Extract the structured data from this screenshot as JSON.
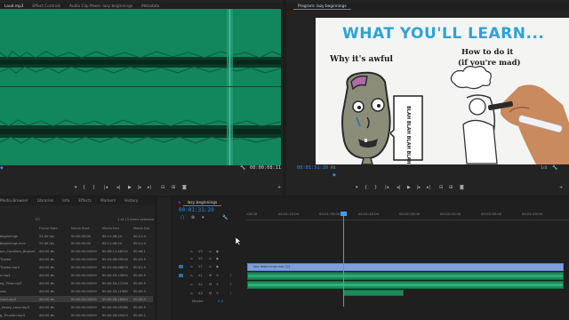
{
  "source_panel": {
    "tabs": [
      "Loud.mp3",
      "Effect Controls",
      "Audio Clip Mixer: lazy beginnings",
      "Metadata"
    ],
    "active_tab": 0,
    "timecode_right": "00:00:08:11",
    "waveform_color": "#12865c"
  },
  "program_panel": {
    "tab_label": "Program: lazy beginnings",
    "timecode": "00:01:31:20",
    "fit": "Fit",
    "fraction": "1/4",
    "frame": {
      "headline": "WHAT YOU'LL LEARN...",
      "left_caption": "Why it's awful",
      "right_caption_line1": "How to do it",
      "right_caption_line2": "(if you're mad)",
      "speech_bubble": "BLAH BLAH BLAH BLAH",
      "headline_color": "#2da3d9"
    }
  },
  "project_panel": {
    "tabs": [
      "Media Browser",
      "Libraries",
      "Info",
      "Effects",
      "Markers",
      "History"
    ],
    "selection_info": "1 of 13 items selected",
    "columns": [
      "Frame Rate",
      "Media Start",
      "Media End",
      "Media Dur"
    ],
    "rows": [
      {
        "name": "beginnings",
        "rate": "25.00 fps",
        "start": "00:00:00:00",
        "end": "00:11:46:24",
        "dur": "00:11:4"
      },
      {
        "name": "beginnings.mov",
        "rate": "25.00 fps",
        "start": "00:00:00:00",
        "end": "00:11:46:24",
        "dur": "00:11:4"
      },
      {
        "name": "om_Cavaliers_Beginni",
        "rate": "44100 Hz",
        "start": "00:00:00:00000",
        "end": "00:06:11:46224",
        "dur": "00:06:1"
      },
      {
        "name": "Theme",
        "rate": "44100 Hz",
        "start": "00:00:00:00000",
        "end": "00:03:58:09016",
        "dur": "00:03:5"
      },
      {
        "name": "Theme.mp3",
        "rate": "44100 Hz",
        "start": "00:00:00:00000",
        "end": "00:01:04:06878",
        "dur": "00:01:0"
      },
      {
        "name": "e.mp3",
        "rate": "44100 Hz",
        "start": "00:00:00:00000",
        "end": "00:00:53:10694",
        "dur": "00:00:5"
      },
      {
        "name": "ng_Time.mp3",
        "rate": "44100 Hz",
        "start": "00:00:00:00000",
        "end": "00:00:54:17226",
        "dur": "00:00:5"
      },
      {
        "name": "udo",
        "rate": "44100 Hz",
        "start": "00:00:00:00000",
        "end": "00:00:33:11960",
        "dur": "00:00:3"
      },
      {
        "name": "Loud.mp3",
        "rate": "44100 Hz",
        "start": "00:00:00:00000",
        "end": "00:00:08:18450",
        "dur": "00:00:0"
      },
      {
        "name": "_Heavy_Loud.mp3",
        "rate": "44100 Hz",
        "start": "00:00:00:00000",
        "end": "00:00:55:05286",
        "dur": "00:00:5"
      },
      {
        "name": "g_Thunder.mp3",
        "rate": "44100 Hz",
        "start": "00:00:00:00000",
        "end": "00:00:28:35423",
        "dur": "00:00:2"
      }
    ],
    "selected_row": 8
  },
  "timeline": {
    "sequence_tab": "lazy beginnings",
    "timecode": "00:01:31:20",
    "ruler": [
      ":00:00",
      "00:01:15:00",
      "00:01:30:00",
      "00:01:45:00",
      "00:02:00:00",
      "00:02:15:00",
      "00:02:30:00",
      "00:02:45:00"
    ],
    "video_clip_label": "lazy beginnings.mov [V]",
    "tracks": [
      "V3",
      "V2",
      "V1",
      "A1",
      "A2",
      "A3"
    ],
    "master_label": "Master",
    "master_value": "0.0",
    "video_clip_color": "#7e9fd9",
    "audio_clip_color": "#1f8a5a"
  }
}
